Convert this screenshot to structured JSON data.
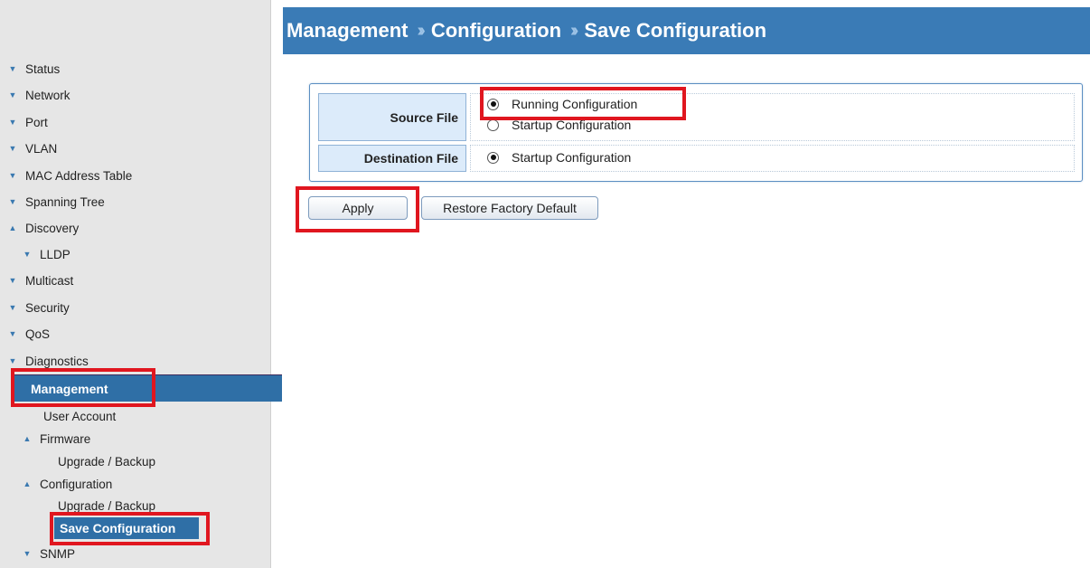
{
  "header": {
    "crumbs": [
      "Management",
      "Configuration",
      "Save Configuration"
    ],
    "separator": "››"
  },
  "sidebar": {
    "items": [
      {
        "label": "Status",
        "chevron": "down"
      },
      {
        "label": "Network",
        "chevron": "down"
      },
      {
        "label": "Port",
        "chevron": "down"
      },
      {
        "label": "VLAN",
        "chevron": "down"
      },
      {
        "label": "MAC Address Table",
        "chevron": "down"
      },
      {
        "label": "Spanning Tree",
        "chevron": "down"
      },
      {
        "label": "Discovery",
        "chevron": "up"
      },
      {
        "label": "LLDP",
        "chevron": "down"
      },
      {
        "label": "Multicast",
        "chevron": "down"
      },
      {
        "label": "Security",
        "chevron": "down"
      },
      {
        "label": "QoS",
        "chevron": "down"
      },
      {
        "label": "Diagnostics",
        "chevron": "down"
      },
      {
        "label": "Management",
        "selected": true
      },
      {
        "label": "User Account"
      },
      {
        "label": "Firmware",
        "chevron": "up"
      },
      {
        "label": "Upgrade / Backup"
      },
      {
        "label": "Configuration",
        "chevron": "up"
      },
      {
        "label": "Upgrade / Backup"
      },
      {
        "label": "Save Configuration",
        "selected": true
      },
      {
        "label": "SNMP",
        "chevron": "down"
      }
    ]
  },
  "form": {
    "source_label": "Source File",
    "source_options": [
      "Running Configuration",
      "Startup Configuration"
    ],
    "source_selected": "Running Configuration",
    "destination_label": "Destination File",
    "destination_options": [
      "Startup Configuration"
    ],
    "destination_selected": "Startup Configuration"
  },
  "buttons": {
    "apply": "Apply",
    "restore": "Restore Factory Default"
  },
  "colors": {
    "header_bg": "#3a7bb6",
    "selected_bg": "#2f6fa6",
    "highlight": "#e0161f",
    "label_bg": "#dcebfa"
  },
  "icons": {
    "expand": "chevron-down-icon",
    "collapse": "chevron-up-icon"
  }
}
